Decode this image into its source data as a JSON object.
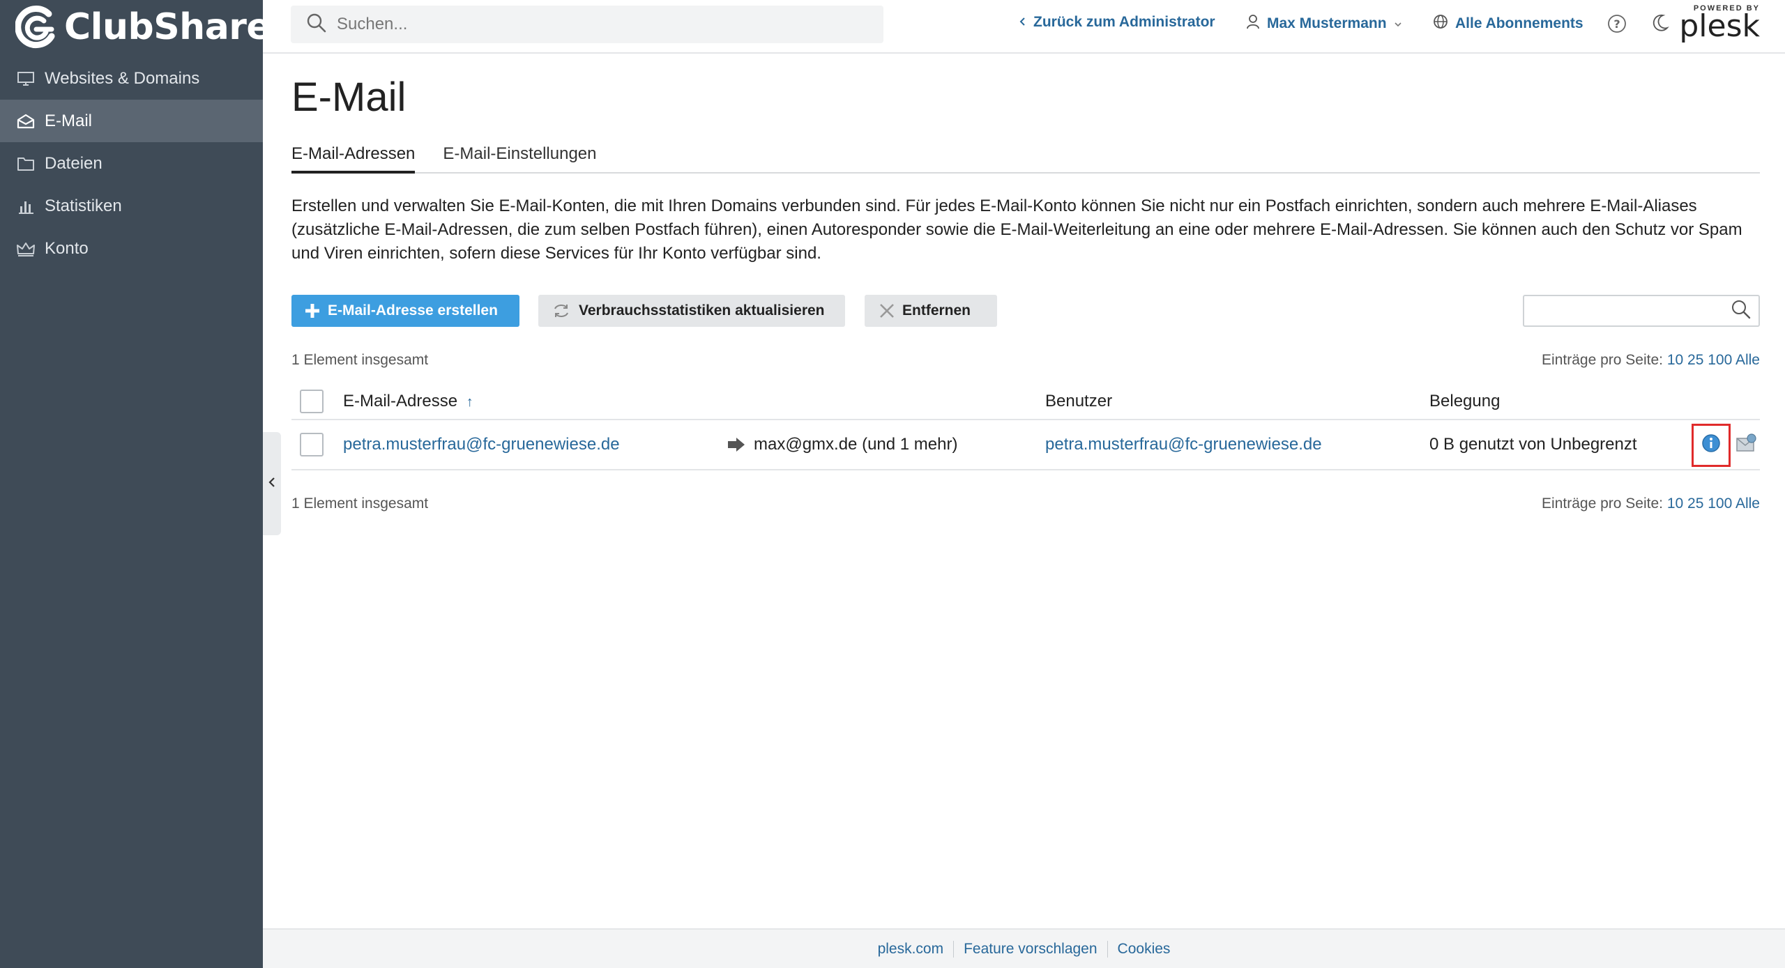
{
  "brand": {
    "name": "ClubShare"
  },
  "sidebar": {
    "items": [
      {
        "label": "Websites & Domains",
        "icon": "monitor-icon"
      },
      {
        "label": "E-Mail",
        "icon": "mail-icon",
        "active": true
      },
      {
        "label": "Dateien",
        "icon": "folder-icon"
      },
      {
        "label": "Statistiken",
        "icon": "bar-chart-icon"
      },
      {
        "label": "Konto",
        "icon": "crown-icon"
      }
    ]
  },
  "header": {
    "search_placeholder": "Suchen...",
    "back_link": "Zurück zum Administrator",
    "user": "Max Mustermann",
    "subscriptions": "Alle Abonnements",
    "powered_by": "POWERED BY",
    "plesk": "plesk"
  },
  "page": {
    "title": "E-Mail",
    "tabs": [
      {
        "label": "E-Mail-Adressen",
        "active": true
      },
      {
        "label": "E-Mail-Einstellungen"
      }
    ],
    "intro": "Erstellen und verwalten Sie E-Mail-Konten, die mit Ihren Domains verbunden sind. Für jedes E-Mail-Konto können Sie nicht nur ein Postfach einrichten, sondern auch mehrere E-Mail-Aliases (zusätzliche E-Mail-Adressen, die zum selben Postfach führen), einen Autoresponder sowie die E-Mail-Weiterleitung an eine oder mehrere E-Mail-Adressen. Sie können auch den Schutz vor Spam und Viren einrichten, sofern diese Services für Ihr Konto verfügbar sind."
  },
  "toolbar": {
    "create": "E-Mail-Adresse erstellen",
    "update_stats": "Verbrauchsstatistiken aktualisieren",
    "remove": "Entfernen"
  },
  "list": {
    "total": "1 Element insgesamt",
    "per_page_label": "Einträge pro Seite:",
    "per_page_options": [
      "10",
      "25",
      "100",
      "Alle"
    ],
    "columns": {
      "email": "E-Mail-Adresse",
      "sort_indicator": "↑",
      "user": "Benutzer",
      "usage": "Belegung"
    },
    "rows": [
      {
        "email": "petra.musterfrau@fc-gruenewiese.de",
        "forward": "max@gmx.de (und 1 mehr)",
        "user": "petra.musterfrau@fc-gruenewiese.de",
        "usage": "0 B genutzt von Unbegrenzt"
      }
    ]
  },
  "footer": {
    "links": [
      "plesk.com",
      "Feature vorschlagen",
      "Cookies"
    ]
  },
  "colors": {
    "sidebar": "#3f4b57",
    "primary": "#3d9ee0",
    "link": "#28689a",
    "highlight": "#e02b2b"
  }
}
